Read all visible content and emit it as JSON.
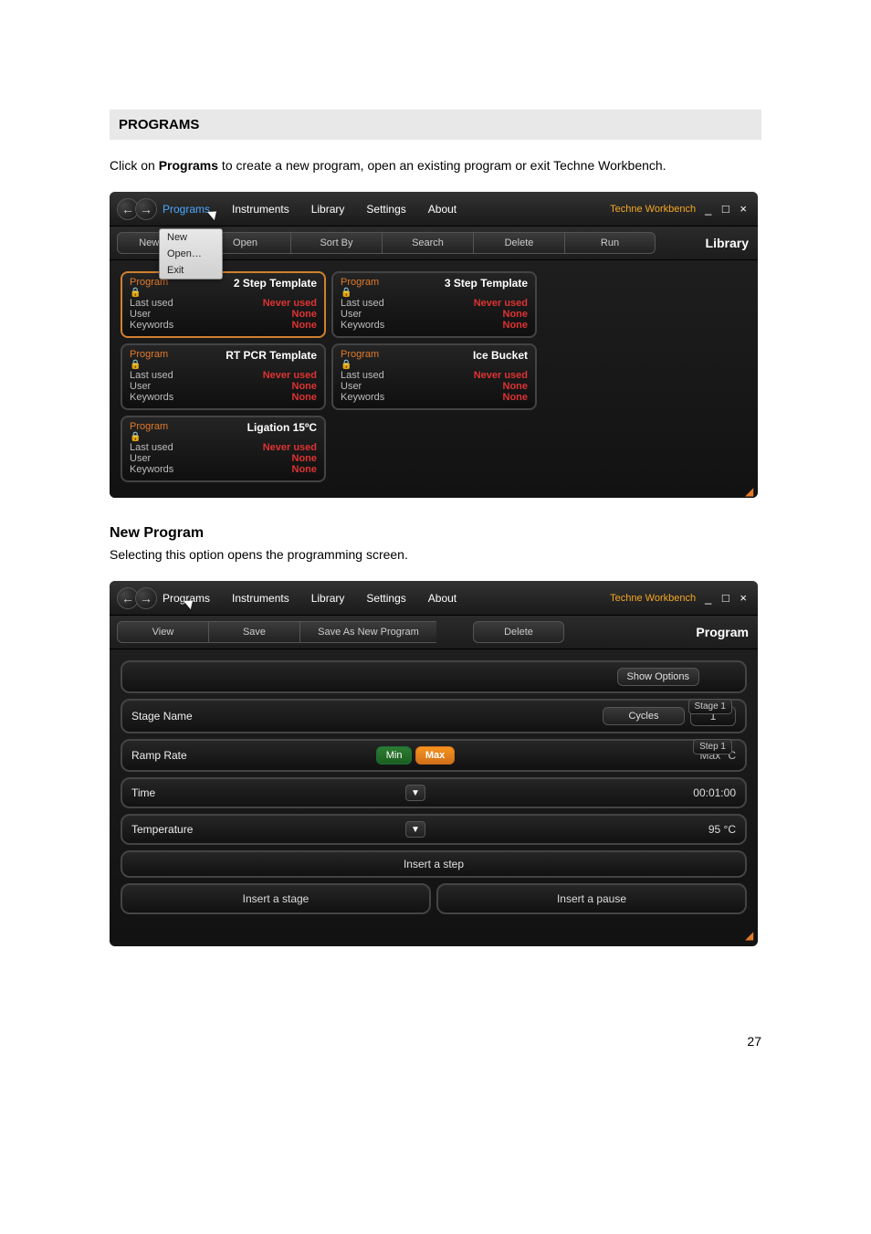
{
  "page": {
    "section_title": "PROGRAMS",
    "intro_pre": "Click on ",
    "intro_bold": "Programs",
    "intro_post": " to create a new program, open an existing program or exit Techne Workbench.",
    "sub_title": "New Program",
    "sub_text": "Selecting this option opens the programming screen.",
    "page_number": "27"
  },
  "app1": {
    "brand": "Techne Workbench",
    "menu": [
      "Programs",
      "Instruments",
      "Library",
      "Settings",
      "About"
    ],
    "dropdown": [
      "New",
      "Open…",
      "Exit"
    ],
    "seg_left": "New P",
    "segs": [
      "Open",
      "Sort By",
      "Search",
      "Delete",
      "Run"
    ],
    "right_label": "Library",
    "card_labels": {
      "type": "Program",
      "last_used": "Last used",
      "user": "User",
      "keywords": "Keywords"
    },
    "cards": [
      {
        "title": "2 Step Template",
        "last": "Never used",
        "user": "None",
        "kw": "None",
        "sel": true
      },
      {
        "title": "3 Step Template",
        "last": "Never used",
        "user": "None",
        "kw": "None",
        "sel": false
      },
      {
        "title": "RT PCR Template",
        "last": "Never used",
        "user": "None",
        "kw": "None",
        "sel": false
      },
      {
        "title": "Ice Bucket",
        "last": "Never used",
        "user": "None",
        "kw": "None",
        "sel": false
      },
      {
        "title": "Ligation 15ºC",
        "last": "Never used",
        "user": "None",
        "kw": "None",
        "sel": false
      }
    ]
  },
  "app2": {
    "brand": "Techne Workbench",
    "menu": [
      "Programs",
      "Instruments",
      "Library",
      "Settings",
      "About"
    ],
    "segs": [
      "View",
      "Save",
      "Save As New Program",
      "Delete"
    ],
    "right_label": "Program",
    "show_options": "Show Options",
    "rows": {
      "stage_name": "Stage Name",
      "cycles_label": "Cycles",
      "cycles_value": "1",
      "stage_badge": "Stage 1",
      "ramp_rate": "Ramp Rate",
      "min": "Min",
      "max": "Max",
      "ramp_value": "Max °C",
      "step_badge": "Step 1",
      "time": "Time",
      "time_value": "00:01:00",
      "temperature": "Temperature",
      "temperature_value": "95 °C",
      "insert_step": "Insert a step",
      "insert_stage": "Insert a stage",
      "insert_pause": "Insert a pause"
    }
  }
}
